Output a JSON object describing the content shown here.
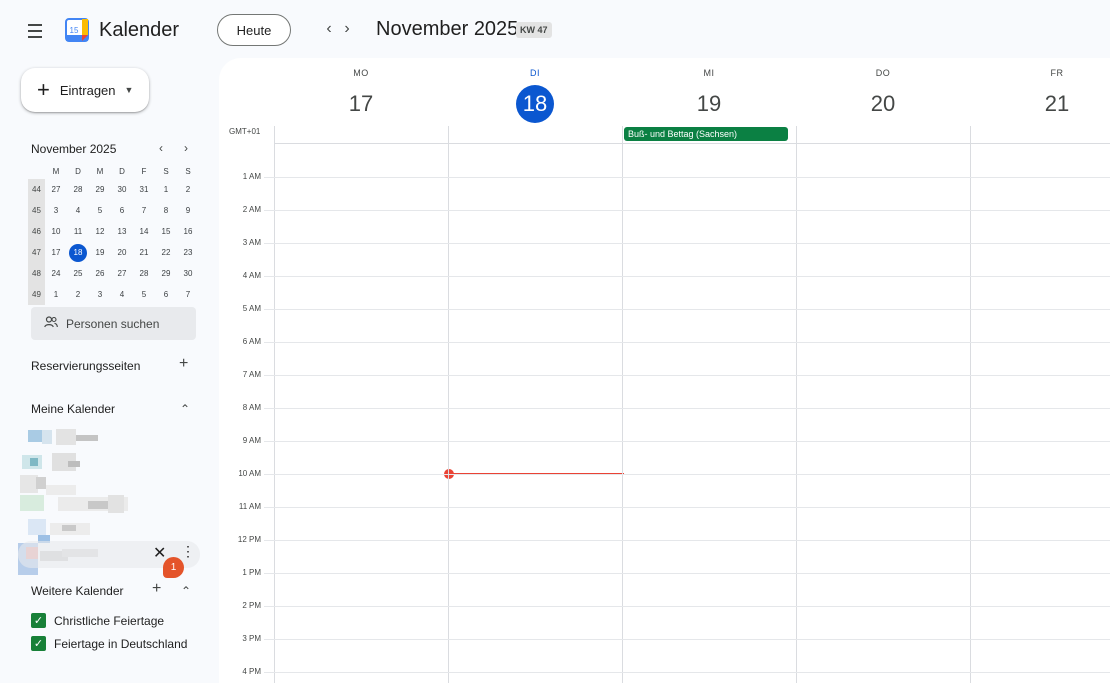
{
  "header": {
    "app_title": "Kalender",
    "logo_day": "15",
    "today_label": "Heute",
    "prev_icon": "‹",
    "next_icon": "›",
    "period": "November 2025",
    "week_badge": "KW 47"
  },
  "sidebar": {
    "create_label": "Eintragen",
    "mini_calendar": {
      "title": "November 2025",
      "weekday_headers": [
        "M",
        "D",
        "M",
        "D",
        "F",
        "S",
        "S"
      ],
      "weeks": [
        {
          "kw": "44",
          "days": [
            "27",
            "28",
            "29",
            "30",
            "31",
            "1",
            "2"
          ]
        },
        {
          "kw": "45",
          "days": [
            "3",
            "4",
            "5",
            "6",
            "7",
            "8",
            "9"
          ]
        },
        {
          "kw": "46",
          "days": [
            "10",
            "11",
            "12",
            "13",
            "14",
            "15",
            "16"
          ]
        },
        {
          "kw": "47",
          "days": [
            "17",
            "18",
            "19",
            "20",
            "21",
            "22",
            "23"
          ]
        },
        {
          "kw": "48",
          "days": [
            "24",
            "25",
            "26",
            "27",
            "28",
            "29",
            "30"
          ]
        },
        {
          "kw": "49",
          "days": [
            "1",
            "2",
            "3",
            "4",
            "5",
            "6",
            "7"
          ]
        }
      ],
      "today": "18"
    },
    "people_search_placeholder": "Personen suchen",
    "booking_pages_label": "Reservierungsseiten",
    "my_calendars_label": "Meine Kalender",
    "other_calendars_label": "Weitere Kalender",
    "notification_count": "1",
    "other_calendars": [
      {
        "label": "Christliche Feiertage",
        "checked": true,
        "color": "#188038"
      },
      {
        "label": "Feiertage in Deutschland",
        "checked": true,
        "color": "#188038"
      }
    ]
  },
  "week_view": {
    "timezone": "GMT+01",
    "days": [
      {
        "dow": "MO",
        "num": "17",
        "today": false
      },
      {
        "dow": "DI",
        "num": "18",
        "today": true
      },
      {
        "dow": "MI",
        "num": "19",
        "today": false
      },
      {
        "dow": "DO",
        "num": "20",
        "today": false
      },
      {
        "dow": "FR",
        "num": "21",
        "today": false
      }
    ],
    "hours": [
      "1 AM",
      "2 AM",
      "3 AM",
      "4 AM",
      "5 AM",
      "6 AM",
      "7 AM",
      "8 AM",
      "9 AM",
      "10 AM",
      "11 AM",
      "12 PM",
      "1 PM",
      "2 PM",
      "3 PM",
      "4 PM"
    ],
    "all_day_events": [
      {
        "title": "Buß- und Bettag (Sachsen)",
        "day": "MI",
        "color": "#0b8043"
      }
    ],
    "current_time_day": "DI"
  },
  "colors": {
    "accent": "#0b57d0",
    "now_line": "#ea4335",
    "event_green": "#0b8043",
    "notification": "#e4542a"
  }
}
